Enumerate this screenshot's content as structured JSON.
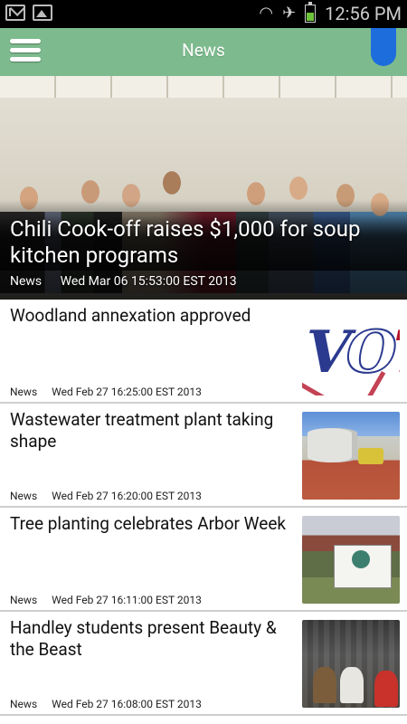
{
  "status_bar": {
    "time": "12:56 PM"
  },
  "app_bar": {
    "title": "News"
  },
  "hero": {
    "title": "Chili Cook-off raises $1,000 for soup kitchen programs",
    "source": "News",
    "date": "Wed Mar 06 15:53:00 EST 2013"
  },
  "articles": [
    {
      "title": "Woodland annexation approved",
      "source": "News",
      "date": "Wed Feb 27 16:25:00 EST 2013",
      "thumb": "vote"
    },
    {
      "title": "Wastewater treatment plant taking shape",
      "source": "News",
      "date": "Wed Feb 27 16:20:00 EST 2013",
      "thumb": "plant"
    },
    {
      "title": "Tree planting celebrates Arbor Week",
      "source": "News",
      "date": "Wed Feb 27 16:11:00 EST 2013",
      "thumb": "arbor"
    },
    {
      "title": "Handley students present Beauty & the Beast",
      "source": "News",
      "date": "Wed Feb 27 16:08:00 EST 2013",
      "thumb": "stage"
    }
  ],
  "colors": {
    "app_bar": "#7dbb8e",
    "scroll_indicator": "#1e6ddd",
    "status_bar": "#000000"
  }
}
